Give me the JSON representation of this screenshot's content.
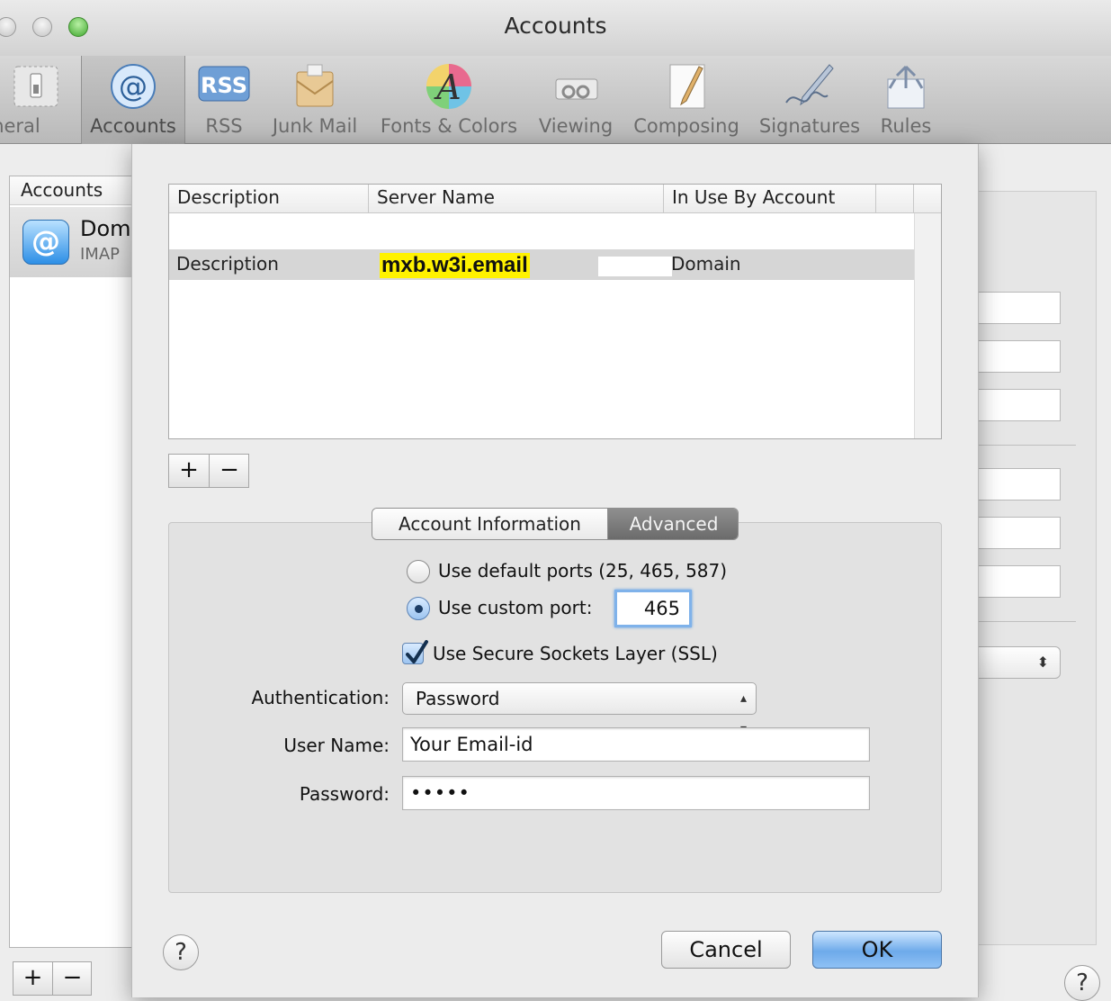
{
  "window": {
    "title": "Accounts"
  },
  "toolbar": {
    "items": [
      {
        "label": "General",
        "icon": "switch-icon"
      },
      {
        "label": "Accounts",
        "icon": "at-sign-icon"
      },
      {
        "label": "RSS",
        "icon": "rss-icon"
      },
      {
        "label": "Junk Mail",
        "icon": "junk-mail-icon"
      },
      {
        "label": "Fonts & Colors",
        "icon": "fonts-colors-icon"
      },
      {
        "label": "Viewing",
        "icon": "viewing-icon"
      },
      {
        "label": "Composing",
        "icon": "composing-icon"
      },
      {
        "label": "Signatures",
        "icon": "signatures-icon"
      },
      {
        "label": "Rules",
        "icon": "rules-icon"
      }
    ],
    "rss_badge": "RSS",
    "fonts_glyph": "A",
    "selected": "Accounts"
  },
  "accounts_pane": {
    "header": "Accounts",
    "account": {
      "name": "Dom",
      "type": "IMAP",
      "icon_glyph": "@"
    },
    "add_label": "+",
    "remove_label": "−",
    "help_label": "?"
  },
  "sheet": {
    "table": {
      "columns": [
        "Description",
        "Server Name",
        "In Use By Account"
      ],
      "rows": [
        {
          "description": "Description",
          "server": "mxb.w3i.email",
          "in_use_by": "Domain",
          "selected": true
        }
      ]
    },
    "add_label": "+",
    "remove_label": "−",
    "tabs": [
      {
        "label": "Account Information",
        "active": false
      },
      {
        "label": "Advanced",
        "active": true
      }
    ],
    "ports": {
      "default_label": "Use default ports (25, 465, 587)",
      "custom_label": "Use custom port:",
      "custom_selected": true,
      "custom_value": "465"
    },
    "ssl": {
      "label": "Use Secure Sockets Layer (SSL)",
      "checked": true
    },
    "authentication": {
      "label": "Authentication:",
      "value": "Password"
    },
    "user_name": {
      "label": "User Name:",
      "value": "Your Email-id"
    },
    "password": {
      "label": "Password:",
      "value": "•••••"
    },
    "help_label": "?",
    "cancel_label": "Cancel",
    "ok_label": "OK"
  },
  "colors": {
    "highlight": "#fff200",
    "default_button": "#6eaaea",
    "active_tab": "#7a7a7a"
  }
}
